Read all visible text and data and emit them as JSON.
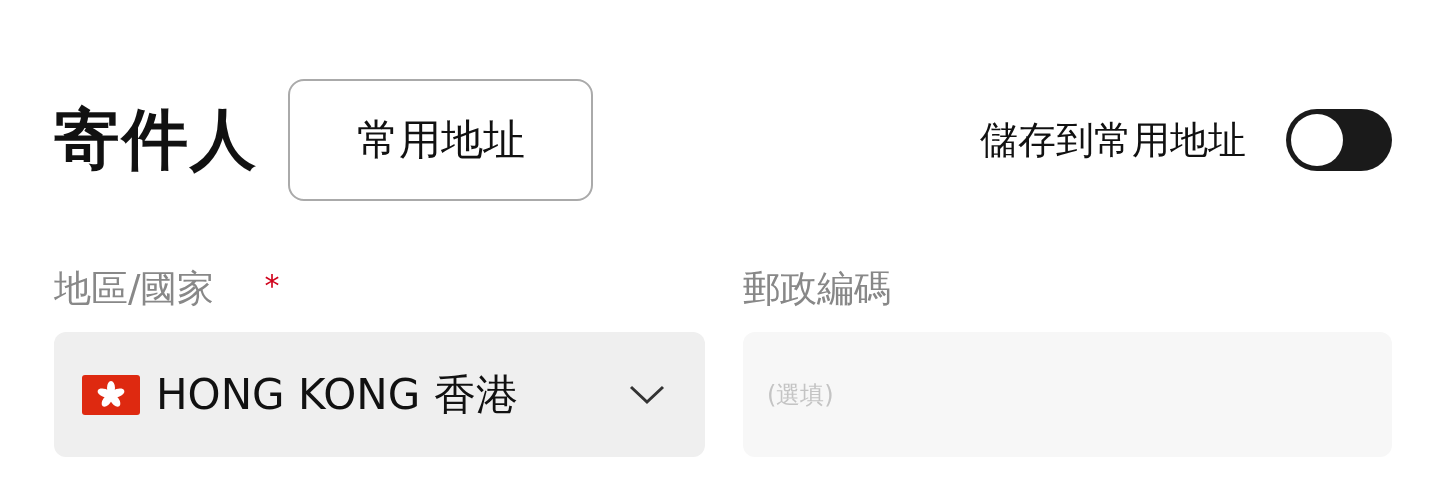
{
  "sender": {
    "title": "寄件人",
    "address_book_button": "常用地址",
    "save_toggle": {
      "label": "儲存到常用地址",
      "on": false
    }
  },
  "fields": [
    {
      "label": "地區/國家",
      "required_mark": "*",
      "kind": "select",
      "value": "HONG KONG 香港"
    },
    {
      "label": "郵政編碼",
      "kind": "text",
      "placeholder": "(選填)"
    }
  ]
}
